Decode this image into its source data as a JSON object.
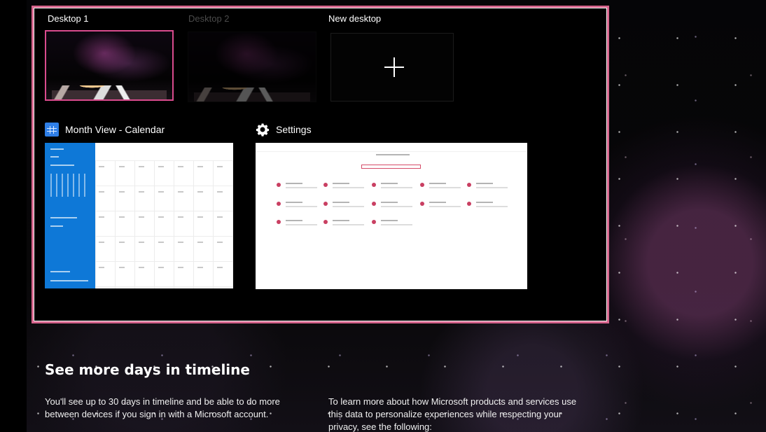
{
  "task_view": {
    "desktops": [
      {
        "label": "Desktop 1",
        "state": "active"
      },
      {
        "label": "Desktop 2",
        "state": "inactive"
      },
      {
        "label": "New desktop",
        "state": "new"
      }
    ],
    "open_windows": [
      {
        "title": "Month View - Calendar",
        "icon": "calendar-icon"
      },
      {
        "title": "Settings",
        "icon": "gear-icon"
      }
    ],
    "colors": {
      "selection_border": "#d6658d",
      "active_desktop_border": "#d94b8d",
      "calendar_sidebar": "#0e78d7",
      "settings_accent": "#c93f62"
    }
  },
  "timeline_info": {
    "heading": "See more days in timeline",
    "left_text": "You'll see up to 30 days in timeline and be able to do more between devices if you sign in with a Microsoft account.",
    "right_text": "To learn more about how Microsoft products and services use this data to personalize experiences while respecting your privacy, see the following:"
  }
}
